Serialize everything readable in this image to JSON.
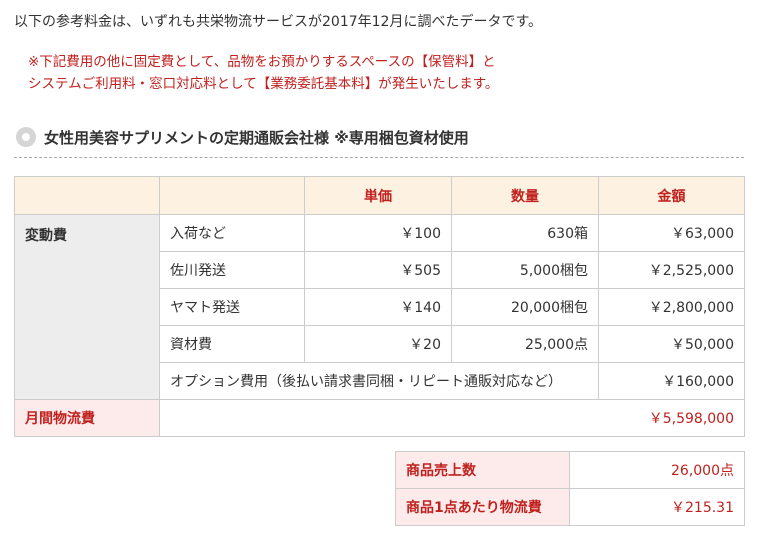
{
  "intro": "以下の参考料金は、いずれも共栄物流サービスが2017年12月に調べたデータです。",
  "note": {
    "line1": "※下記費用の他に固定費として、品物をお預かりするスペースの【保管料】と",
    "line2": "システムご利用料・窓口対応料として【業務委託基本料】が発生いたします。"
  },
  "section_title": "女性用美容サプリメントの定期通販会社様 ※専用梱包資材使用",
  "table": {
    "headers": [
      "単価",
      "数量",
      "金額"
    ],
    "variable_label": "変動費",
    "rows": [
      {
        "item": "入荷など",
        "unit": "￥100",
        "qty": "630箱",
        "amount": "￥63,000"
      },
      {
        "item": "佐川発送",
        "unit": "￥505",
        "qty": "5,000梱包",
        "amount": "￥2,525,000"
      },
      {
        "item": "ヤマト発送",
        "unit": "￥140",
        "qty": "20,000梱包",
        "amount": "￥2,800,000"
      },
      {
        "item": "資材費",
        "unit": "￥20",
        "qty": "25,000点",
        "amount": "￥50,000"
      }
    ],
    "option_row": {
      "item": "オプション費用（後払い請求書同梱・リピート通販対応など）",
      "amount": "￥160,000"
    },
    "total": {
      "label": "月間物流費",
      "amount": "￥5,598,000"
    }
  },
  "summary": {
    "sales_label": "商品売上数",
    "sales_value": "26,000点",
    "per_item_label": "商品1点あたり物流費",
    "per_item_value": "￥215.31"
  },
  "colors": {
    "accent_red": "#c0211e",
    "header_bg": "#fdf2e1",
    "pink_bg": "#fdeaea",
    "gray_bg": "#ededed"
  }
}
